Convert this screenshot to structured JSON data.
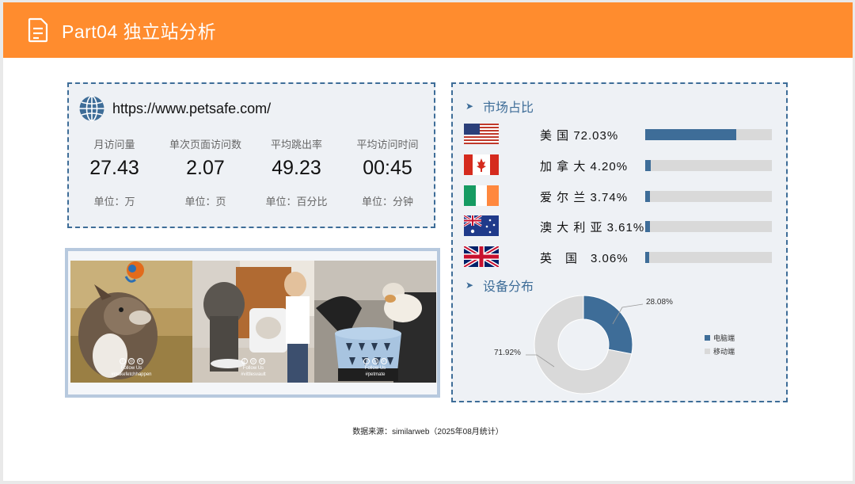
{
  "header": {
    "title": "Part04 独立站分析"
  },
  "website": {
    "url": "https://www.petsafe.com/",
    "stats": [
      {
        "label": "月访问量",
        "value": "27.43",
        "unit": "单位：万"
      },
      {
        "label": "单次页面访问数",
        "value": "2.07",
        "unit": "单位：页"
      },
      {
        "label": "平均跳出率",
        "value": "49.23",
        "unit": "单位：百分比"
      },
      {
        "label": "平均访问时间",
        "value": "00:45",
        "unit": "单位：分钟"
      }
    ]
  },
  "photos": [
    {
      "follow": "Follow Us",
      "tag": "#makefetchhappen"
    },
    {
      "follow": "Follow Us",
      "tag": "#vittlesvault"
    },
    {
      "follow": "Follow Us",
      "tag": "#petmate"
    }
  ],
  "market": {
    "heading": "市场占比",
    "countries": [
      {
        "name": "美 国 72.03%",
        "share": 72.03,
        "flag": "us-flag"
      },
      {
        "name": "加 拿 大 4.20%",
        "share": 4.2,
        "flag": "canada-flag"
      },
      {
        "name": "爱 尔 兰 3.74%",
        "share": 3.74,
        "flag": "ireland-flag"
      },
      {
        "name": "澳 大 利 亚 3.61%",
        "share": 3.61,
        "flag": "australia-flag"
      },
      {
        "name": "英　国　3.06%",
        "share": 3.06,
        "flag": "uk-flag"
      }
    ],
    "bar_max": 100,
    "bar_color": "#3e6d98",
    "track_color": "#d9d9d9"
  },
  "device": {
    "heading": "设备分布",
    "chart_data": {
      "type": "pie",
      "categories": [
        "电脑端",
        "移动端"
      ],
      "values": [
        28.08,
        71.92
      ],
      "labels": [
        "28.08%",
        "71.92%"
      ],
      "colors": [
        "#3e6d98",
        "#d9d9d9"
      ],
      "legend": "right"
    }
  },
  "footer": {
    "source": "数据来源：similarweb（2025年08月统计）"
  },
  "colors": {
    "header": "#ff8c2e",
    "accent": "#3e6d98"
  }
}
